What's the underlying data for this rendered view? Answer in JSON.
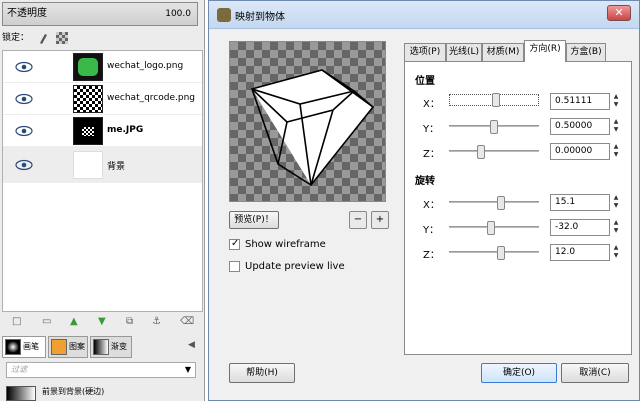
{
  "layers_panel": {
    "opacity_label": "不透明度",
    "opacity_value": "100.0",
    "lock_label": "锁定：",
    "layers": [
      {
        "name": "wechat_logo.png"
      },
      {
        "name": "wechat_qrcode.png"
      },
      {
        "name": "me.JPG"
      },
      {
        "name": "背景"
      }
    ],
    "tool_tabs": [
      "画笔",
      "图案",
      "渐变"
    ],
    "filter_placeholder": "过滤",
    "gradient_name": "前景到背景(硬边)"
  },
  "dialog": {
    "title": "映射到物体",
    "preview_button": "预览(P)！",
    "show_wireframe": {
      "label": "Show wireframe",
      "checked": true
    },
    "update_preview_live": {
      "label": "Update preview live",
      "checked": false
    },
    "tabs": [
      "选项(P)",
      "光线(L)",
      "材质(M)",
      "方向(R)",
      "方盒(B)"
    ],
    "active_tab": "方向(R)",
    "position": {
      "title": "位置",
      "x_label": "X：",
      "x_value": "0.51111",
      "x_level": 0.51111,
      "y_label": "Y：",
      "y_value": "0.50000",
      "y_level": 0.5,
      "z_label": "Z：",
      "z_value": "0.00000",
      "z_level": 0.0
    },
    "rotation": {
      "title": "旋转",
      "x_label": "X：",
      "x_value": "15.1",
      "y_label": "Y：",
      "y_value": "-32.0",
      "z_label": "Z：",
      "z_value": "12.0"
    },
    "help_button": "帮助(H)",
    "ok_button": "确定(O)",
    "cancel_button": "取消(C)"
  }
}
